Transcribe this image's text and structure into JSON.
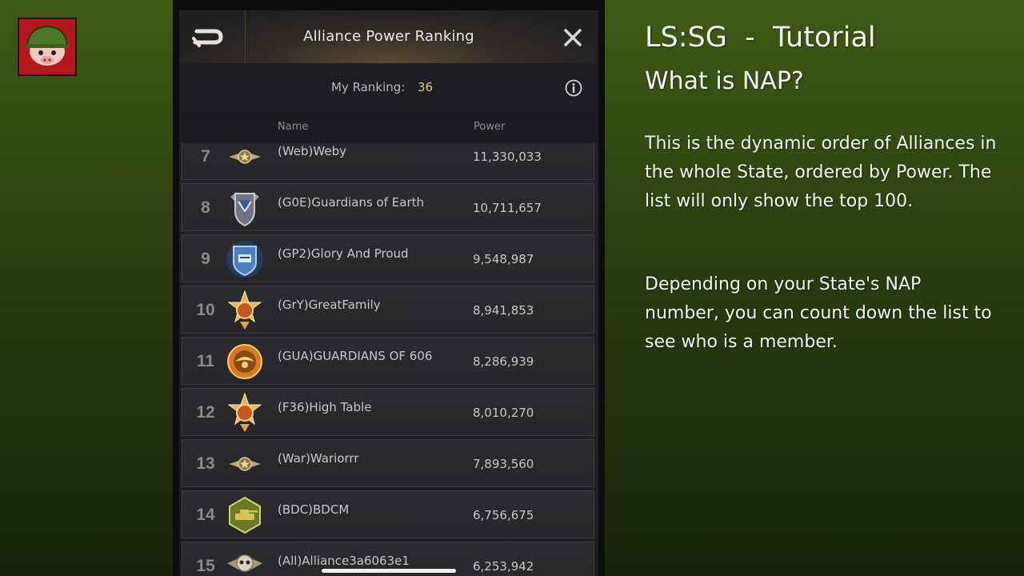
{
  "panel": {
    "title": "Alliance Power Ranking",
    "my_ranking_label": "My Ranking:",
    "my_ranking_value": "36",
    "columns": {
      "name": "Name",
      "power": "Power"
    },
    "rows": [
      {
        "rank": "7",
        "name": "(Web)Weby",
        "power": "11,330,033",
        "emblem": "star-wing-emblem"
      },
      {
        "rank": "8",
        "name": "(G0E)Guardians of Earth",
        "power": "10,711,657",
        "emblem": "silver-shield-emblem"
      },
      {
        "rank": "9",
        "name": "(GP2)Glory And Proud",
        "power": "9,548,987",
        "emblem": "blue-shield-emblem"
      },
      {
        "rank": "10",
        "name": "(GrY)GreatFamily",
        "power": "8,941,853",
        "emblem": "gold-star-emblem"
      },
      {
        "rank": "11",
        "name": "(GUA)GUARDIANS OF 606",
        "power": "8,286,939",
        "emblem": "flame-eagle-emblem"
      },
      {
        "rank": "12",
        "name": "(F36)High Table",
        "power": "8,010,270",
        "emblem": "gold-star-emblem"
      },
      {
        "rank": "13",
        "name": "(War)Wariorrr",
        "power": "7,893,560",
        "emblem": "star-wing-emblem"
      },
      {
        "rank": "14",
        "name": "(BDC)BDCM",
        "power": "6,756,675",
        "emblem": "tank-hexagon-emblem"
      },
      {
        "rank": "15",
        "name": "(All)Alliance3a6063e1",
        "power": "6,253,942",
        "emblem": "skull-wing-emblem"
      }
    ]
  },
  "tutorial": {
    "title": "LS:SG  -  Tutorial",
    "subtitle": "What is NAP?",
    "paragraph1": "This is the dynamic order of Alliances in the whole State, ordered by Power. The list will only show the top 100.",
    "paragraph2": "Depending on your State's NAP number, you can count down the list to see who is a member."
  },
  "colors": {
    "accent_gold": "#e7c889",
    "background_green": "#3f5a14",
    "logo_red": "#b3191c"
  }
}
